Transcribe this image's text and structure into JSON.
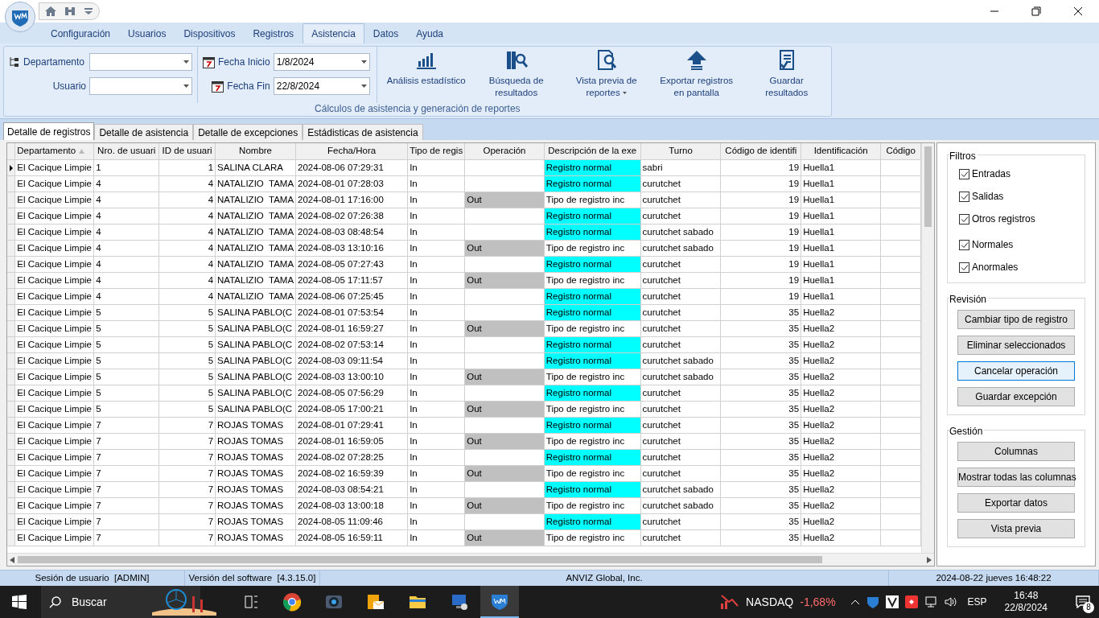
{
  "ribbon_tabs": [
    {
      "label": "Configuración",
      "selected": false
    },
    {
      "label": "Usuarios",
      "selected": false
    },
    {
      "label": "Dispositivos",
      "selected": false
    },
    {
      "label": "Registros",
      "selected": false
    },
    {
      "label": "Asistencia",
      "selected": true
    },
    {
      "label": "Datos",
      "selected": false
    },
    {
      "label": "Ayuda",
      "selected": false
    }
  ],
  "filters": {
    "department_label": "Departamento",
    "user_label": "Usuario",
    "start_label": "Fecha Inicio",
    "start_value": "1/8/2024",
    "end_label": "Fecha Fin",
    "end_value": "22/8/2024"
  },
  "ribbon_buttons": [
    {
      "kind": "chart",
      "label": "Análisis estadístico"
    },
    {
      "kind": "search",
      "label": "Búsqueda de resultados"
    },
    {
      "kind": "preview",
      "label": "Vista previa de reportes",
      "dropdown": true
    },
    {
      "kind": "export",
      "label": "Exportar registros en pantalla"
    },
    {
      "kind": "save",
      "label": "Guardar resultados"
    }
  ],
  "ribbon_group_label": "Cálculos de asistencia y generación de reportes",
  "view_tabs": [
    {
      "label": "Detalle de registros",
      "selected": true
    },
    {
      "label": "Detalle de asistencia",
      "selected": false
    },
    {
      "label": "Detalle de excepciones",
      "selected": false
    },
    {
      "label": "Estádisticas de asistencia",
      "selected": false
    }
  ],
  "table": {
    "columns": [
      "Departamento",
      "Nro. de usuari",
      "ID de usuari",
      "Nombre",
      "Fecha/Hora",
      "Tipo de regis",
      "Operación",
      "Descripción de la exe",
      "Turno",
      "Código de identifi",
      "Identificación",
      "Código"
    ],
    "rows": [
      {
        "selected": true,
        "exception": false,
        "cells": [
          "El Cacique Limpie",
          "1",
          "1",
          "SALINA CLARA",
          "2024-08-06 07:29:31",
          "In",
          "",
          "Registro normal",
          "sabri",
          "19",
          "Huella1"
        ]
      },
      {
        "selected": false,
        "exception": false,
        "cells": [
          "El Cacique Limpie",
          "4",
          "4",
          "NATALIZIO  TAMA",
          "2024-08-01 07:28:03",
          "In",
          "",
          "Registro normal",
          "curutchet",
          "19",
          "Huella1"
        ]
      },
      {
        "selected": false,
        "exception": true,
        "cells": [
          "El Cacique Limpie",
          "4",
          "4",
          "NATALIZIO  TAMA",
          "2024-08-01 17:16:00",
          "In",
          "Out",
          "Tipo de registro inc",
          "curutchet",
          "19",
          "Huella1"
        ]
      },
      {
        "selected": false,
        "exception": false,
        "cells": [
          "El Cacique Limpie",
          "4",
          "4",
          "NATALIZIO  TAMA",
          "2024-08-02 07:26:38",
          "In",
          "",
          "Registro normal",
          "curutchet",
          "19",
          "Huella1"
        ]
      },
      {
        "selected": false,
        "exception": false,
        "cells": [
          "El Cacique Limpie",
          "4",
          "4",
          "NATALIZIO  TAMA",
          "2024-08-03 08:48:54",
          "In",
          "",
          "Registro normal",
          "curutchet sabado",
          "19",
          "Huella1"
        ]
      },
      {
        "selected": false,
        "exception": true,
        "cells": [
          "El Cacique Limpie",
          "4",
          "4",
          "NATALIZIO  TAMA",
          "2024-08-03 13:10:16",
          "In",
          "Out",
          "Tipo de registro inc",
          "curutchet sabado",
          "19",
          "Huella1"
        ]
      },
      {
        "selected": false,
        "exception": false,
        "cells": [
          "El Cacique Limpie",
          "4",
          "4",
          "NATALIZIO  TAMA",
          "2024-08-05 07:27:43",
          "In",
          "",
          "Registro normal",
          "curutchet",
          "19",
          "Huella1"
        ]
      },
      {
        "selected": false,
        "exception": true,
        "cells": [
          "El Cacique Limpie",
          "4",
          "4",
          "NATALIZIO  TAMA",
          "2024-08-05 17:11:57",
          "In",
          "Out",
          "Tipo de registro inc",
          "curutchet",
          "19",
          "Huella1"
        ]
      },
      {
        "selected": false,
        "exception": false,
        "cells": [
          "El Cacique Limpie",
          "4",
          "4",
          "NATALIZIO  TAMA",
          "2024-08-06 07:25:45",
          "In",
          "",
          "Registro normal",
          "curutchet",
          "19",
          "Huella1"
        ]
      },
      {
        "selected": false,
        "exception": false,
        "cells": [
          "El Cacique Limpie",
          "5",
          "5",
          "SALINA PABLO(C",
          "2024-08-01 07:53:54",
          "In",
          "",
          "Registro normal",
          "curutchet",
          "35",
          "Huella2"
        ]
      },
      {
        "selected": false,
        "exception": true,
        "cells": [
          "El Cacique Limpie",
          "5",
          "5",
          "SALINA PABLO(C",
          "2024-08-01 16:59:27",
          "In",
          "Out",
          "Tipo de registro inc",
          "curutchet",
          "35",
          "Huella2"
        ]
      },
      {
        "selected": false,
        "exception": false,
        "cells": [
          "El Cacique Limpie",
          "5",
          "5",
          "SALINA PABLO(C",
          "2024-08-02 07:53:14",
          "In",
          "",
          "Registro normal",
          "curutchet",
          "35",
          "Huella2"
        ]
      },
      {
        "selected": false,
        "exception": false,
        "cells": [
          "El Cacique Limpie",
          "5",
          "5",
          "SALINA PABLO(C",
          "2024-08-03 09:11:54",
          "In",
          "",
          "Registro normal",
          "curutchet sabado",
          "35",
          "Huella2"
        ]
      },
      {
        "selected": false,
        "exception": true,
        "cells": [
          "El Cacique Limpie",
          "5",
          "5",
          "SALINA PABLO(C",
          "2024-08-03 13:00:10",
          "In",
          "Out",
          "Tipo de registro inc",
          "curutchet sabado",
          "35",
          "Huella2"
        ]
      },
      {
        "selected": false,
        "exception": false,
        "cells": [
          "El Cacique Limpie",
          "5",
          "5",
          "SALINA PABLO(C",
          "2024-08-05 07:56:29",
          "In",
          "",
          "Registro normal",
          "curutchet",
          "35",
          "Huella2"
        ]
      },
      {
        "selected": false,
        "exception": true,
        "cells": [
          "El Cacique Limpie",
          "5",
          "5",
          "SALINA PABLO(C",
          "2024-08-05 17:00:21",
          "In",
          "Out",
          "Tipo de registro inc",
          "curutchet",
          "35",
          "Huella2"
        ]
      },
      {
        "selected": false,
        "exception": false,
        "cells": [
          "El Cacique Limpie",
          "7",
          "7",
          "ROJAS TOMAS",
          "2024-08-01 07:29:41",
          "In",
          "",
          "Registro normal",
          "curutchet",
          "35",
          "Huella2"
        ]
      },
      {
        "selected": false,
        "exception": true,
        "cells": [
          "El Cacique Limpie",
          "7",
          "7",
          "ROJAS TOMAS",
          "2024-08-01 16:59:05",
          "In",
          "Out",
          "Tipo de registro inc",
          "curutchet",
          "35",
          "Huella2"
        ]
      },
      {
        "selected": false,
        "exception": false,
        "cells": [
          "El Cacique Limpie",
          "7",
          "7",
          "ROJAS TOMAS",
          "2024-08-02 07:28:25",
          "In",
          "",
          "Registro normal",
          "curutchet",
          "35",
          "Huella2"
        ]
      },
      {
        "selected": false,
        "exception": true,
        "cells": [
          "El Cacique Limpie",
          "7",
          "7",
          "ROJAS TOMAS",
          "2024-08-02 16:59:39",
          "In",
          "Out",
          "Tipo de registro inc",
          "curutchet",
          "35",
          "Huella2"
        ]
      },
      {
        "selected": false,
        "exception": false,
        "cells": [
          "El Cacique Limpie",
          "7",
          "7",
          "ROJAS TOMAS",
          "2024-08-03 08:54:21",
          "In",
          "",
          "Registro normal",
          "curutchet sabado",
          "35",
          "Huella2"
        ]
      },
      {
        "selected": false,
        "exception": true,
        "cells": [
          "El Cacique Limpie",
          "7",
          "7",
          "ROJAS TOMAS",
          "2024-08-03 13:00:18",
          "In",
          "Out",
          "Tipo de registro inc",
          "curutchet sabado",
          "35",
          "Huella2"
        ]
      },
      {
        "selected": false,
        "exception": false,
        "cells": [
          "El Cacique Limpie",
          "7",
          "7",
          "ROJAS TOMAS",
          "2024-08-05 11:09:46",
          "In",
          "",
          "Registro normal",
          "curutchet",
          "35",
          "Huella2"
        ]
      },
      {
        "selected": false,
        "exception": true,
        "cells": [
          "El Cacique Limpie",
          "7",
          "7",
          "ROJAS TOMAS",
          "2024-08-05 16:59:11",
          "In",
          "Out",
          "Tipo de registro inc",
          "curutchet",
          "35",
          "Huella2"
        ]
      }
    ]
  },
  "side_panel": {
    "filters_title": "Filtros",
    "filters": [
      {
        "label": "Entradas",
        "checked": true
      },
      {
        "label": "Salidas",
        "checked": true
      },
      {
        "label": "Otros registros",
        "checked": true
      },
      {
        "label": "Normales",
        "checked": true
      },
      {
        "label": "Anormales",
        "checked": true
      }
    ],
    "review_title": "Revisión",
    "review_buttons": [
      {
        "label": "Cambiar tipo de registro",
        "selected": false
      },
      {
        "label": "Eliminar seleccionados",
        "selected": false
      },
      {
        "label": "Cancelar operación",
        "selected": true
      },
      {
        "label": "Guardar excepción",
        "selected": false
      }
    ],
    "management_title": "Gestión",
    "management_buttons": [
      "Columnas",
      "Mostrar todas las columnas",
      "Exportar datos",
      "Vista previa"
    ]
  },
  "status_bar": [
    "Sesión de usuario  [ADMIN]",
    "Versión del software  [4.3.15.0]",
    "ANVIZ Global, Inc.",
    "2024-08-22 jueves 16:48:22"
  ],
  "taskbar": {
    "search": "Buscar",
    "stock_name": "NASDAQ",
    "stock_change": "-1,68%",
    "language": "ESP",
    "time": "16:48",
    "date": "22/8/2024",
    "notifications": "8"
  }
}
